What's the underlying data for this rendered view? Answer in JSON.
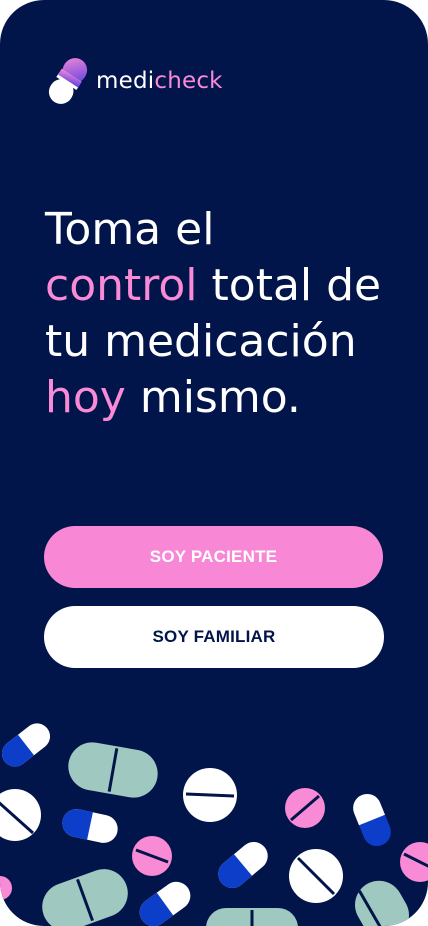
{
  "brand": {
    "name_prefix": "medi",
    "name_suffix": "check",
    "logo_icon": "capsule-icon"
  },
  "headline": {
    "line1": "Toma el",
    "line2_highlight": "control",
    "line2_rest": " total de",
    "line3": "tu medicación",
    "line4_highlight": "hoy",
    "line4_rest": " mismo."
  },
  "buttons": {
    "patient_label": "SOY PACIENTE",
    "family_label": "SOY FAMILIAR"
  },
  "decoration": {
    "illustration": "pills-illustration"
  },
  "colors": {
    "background": "#02154a",
    "accent_pink": "#f88ad6",
    "pill_blue": "#0d3ec9",
    "pill_mint": "#9fc8c0",
    "white": "#ffffff"
  }
}
